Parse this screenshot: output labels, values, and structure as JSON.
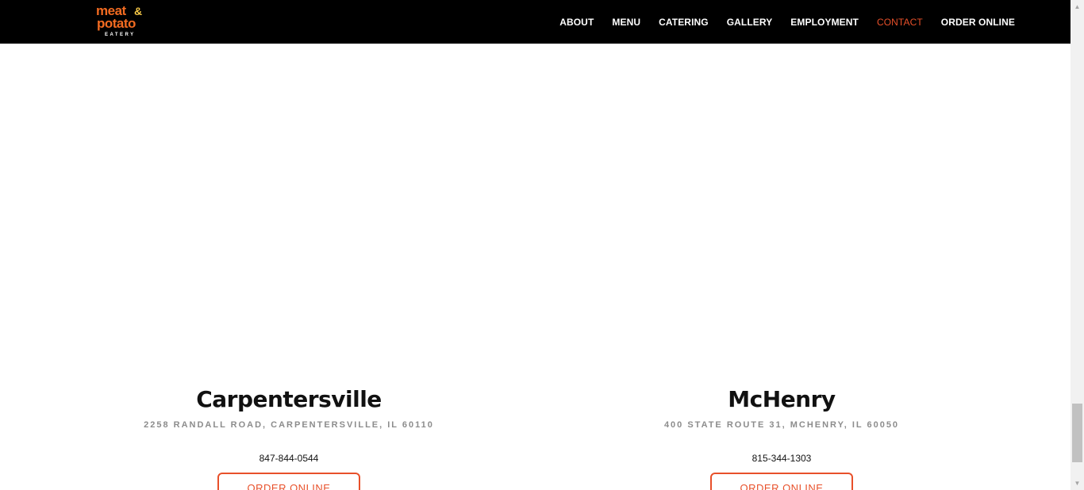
{
  "header": {
    "logo": {
      "line1": "meat",
      "amp": "&",
      "line2": "potato",
      "line3": "EATERY"
    },
    "nav": [
      {
        "label": "ABOUT"
      },
      {
        "label": "MENU"
      },
      {
        "label": "CATERING"
      },
      {
        "label": "GALLERY"
      },
      {
        "label": "EMPLOYMENT"
      },
      {
        "label": "CONTACT",
        "active": true
      },
      {
        "label": "ORDER ONLINE"
      }
    ]
  },
  "locations": [
    {
      "name": "Carpentersville",
      "address": "2258 RANDALL ROAD, CARPENTERSVILLE, IL 60110",
      "phone": "847-844-0544",
      "button": "ORDER ONLINE"
    },
    {
      "name": "McHenry",
      "address": "400 STATE ROUTE 31, MCHENRY, IL 60050",
      "phone": "815-344-1303",
      "button": "ORDER ONLINE"
    }
  ],
  "colors": {
    "header_bg": "#000000",
    "accent": "#e8502a",
    "logo_orange": "#f26b21",
    "logo_yellow": "#f7c948",
    "address_gray": "#8c8c8c"
  },
  "icons": {
    "scroll_up": "triangle-up",
    "scroll_down": "triangle-down"
  }
}
